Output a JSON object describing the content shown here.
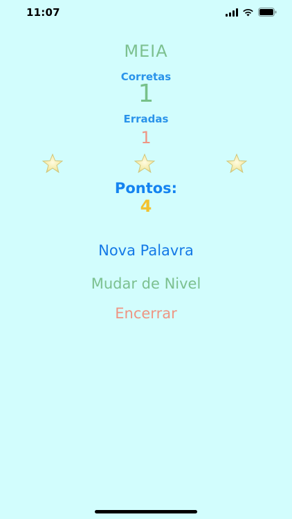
{
  "status_bar": {
    "time": "11:07",
    "icons": [
      "signal-icon",
      "wifi-icon",
      "battery-icon"
    ]
  },
  "game": {
    "level": "MEIA",
    "correct_label": "Corretas",
    "correct_value": "1",
    "wrong_label": "Erradas",
    "wrong_value": "1",
    "stars": [
      "star-icon",
      "star-icon",
      "star-icon"
    ],
    "points_label": "Pontos:",
    "points_value": "4"
  },
  "actions": {
    "new_word": "Nova Palavra",
    "change_level": "Mudar de Nivel",
    "quit": "Encerrar"
  },
  "colors": {
    "background": "#d2fdfd",
    "accent_blue": "#1479e6",
    "green": "#7cc08f",
    "salmon": "#ee9583",
    "gold": "#f2c22f"
  }
}
